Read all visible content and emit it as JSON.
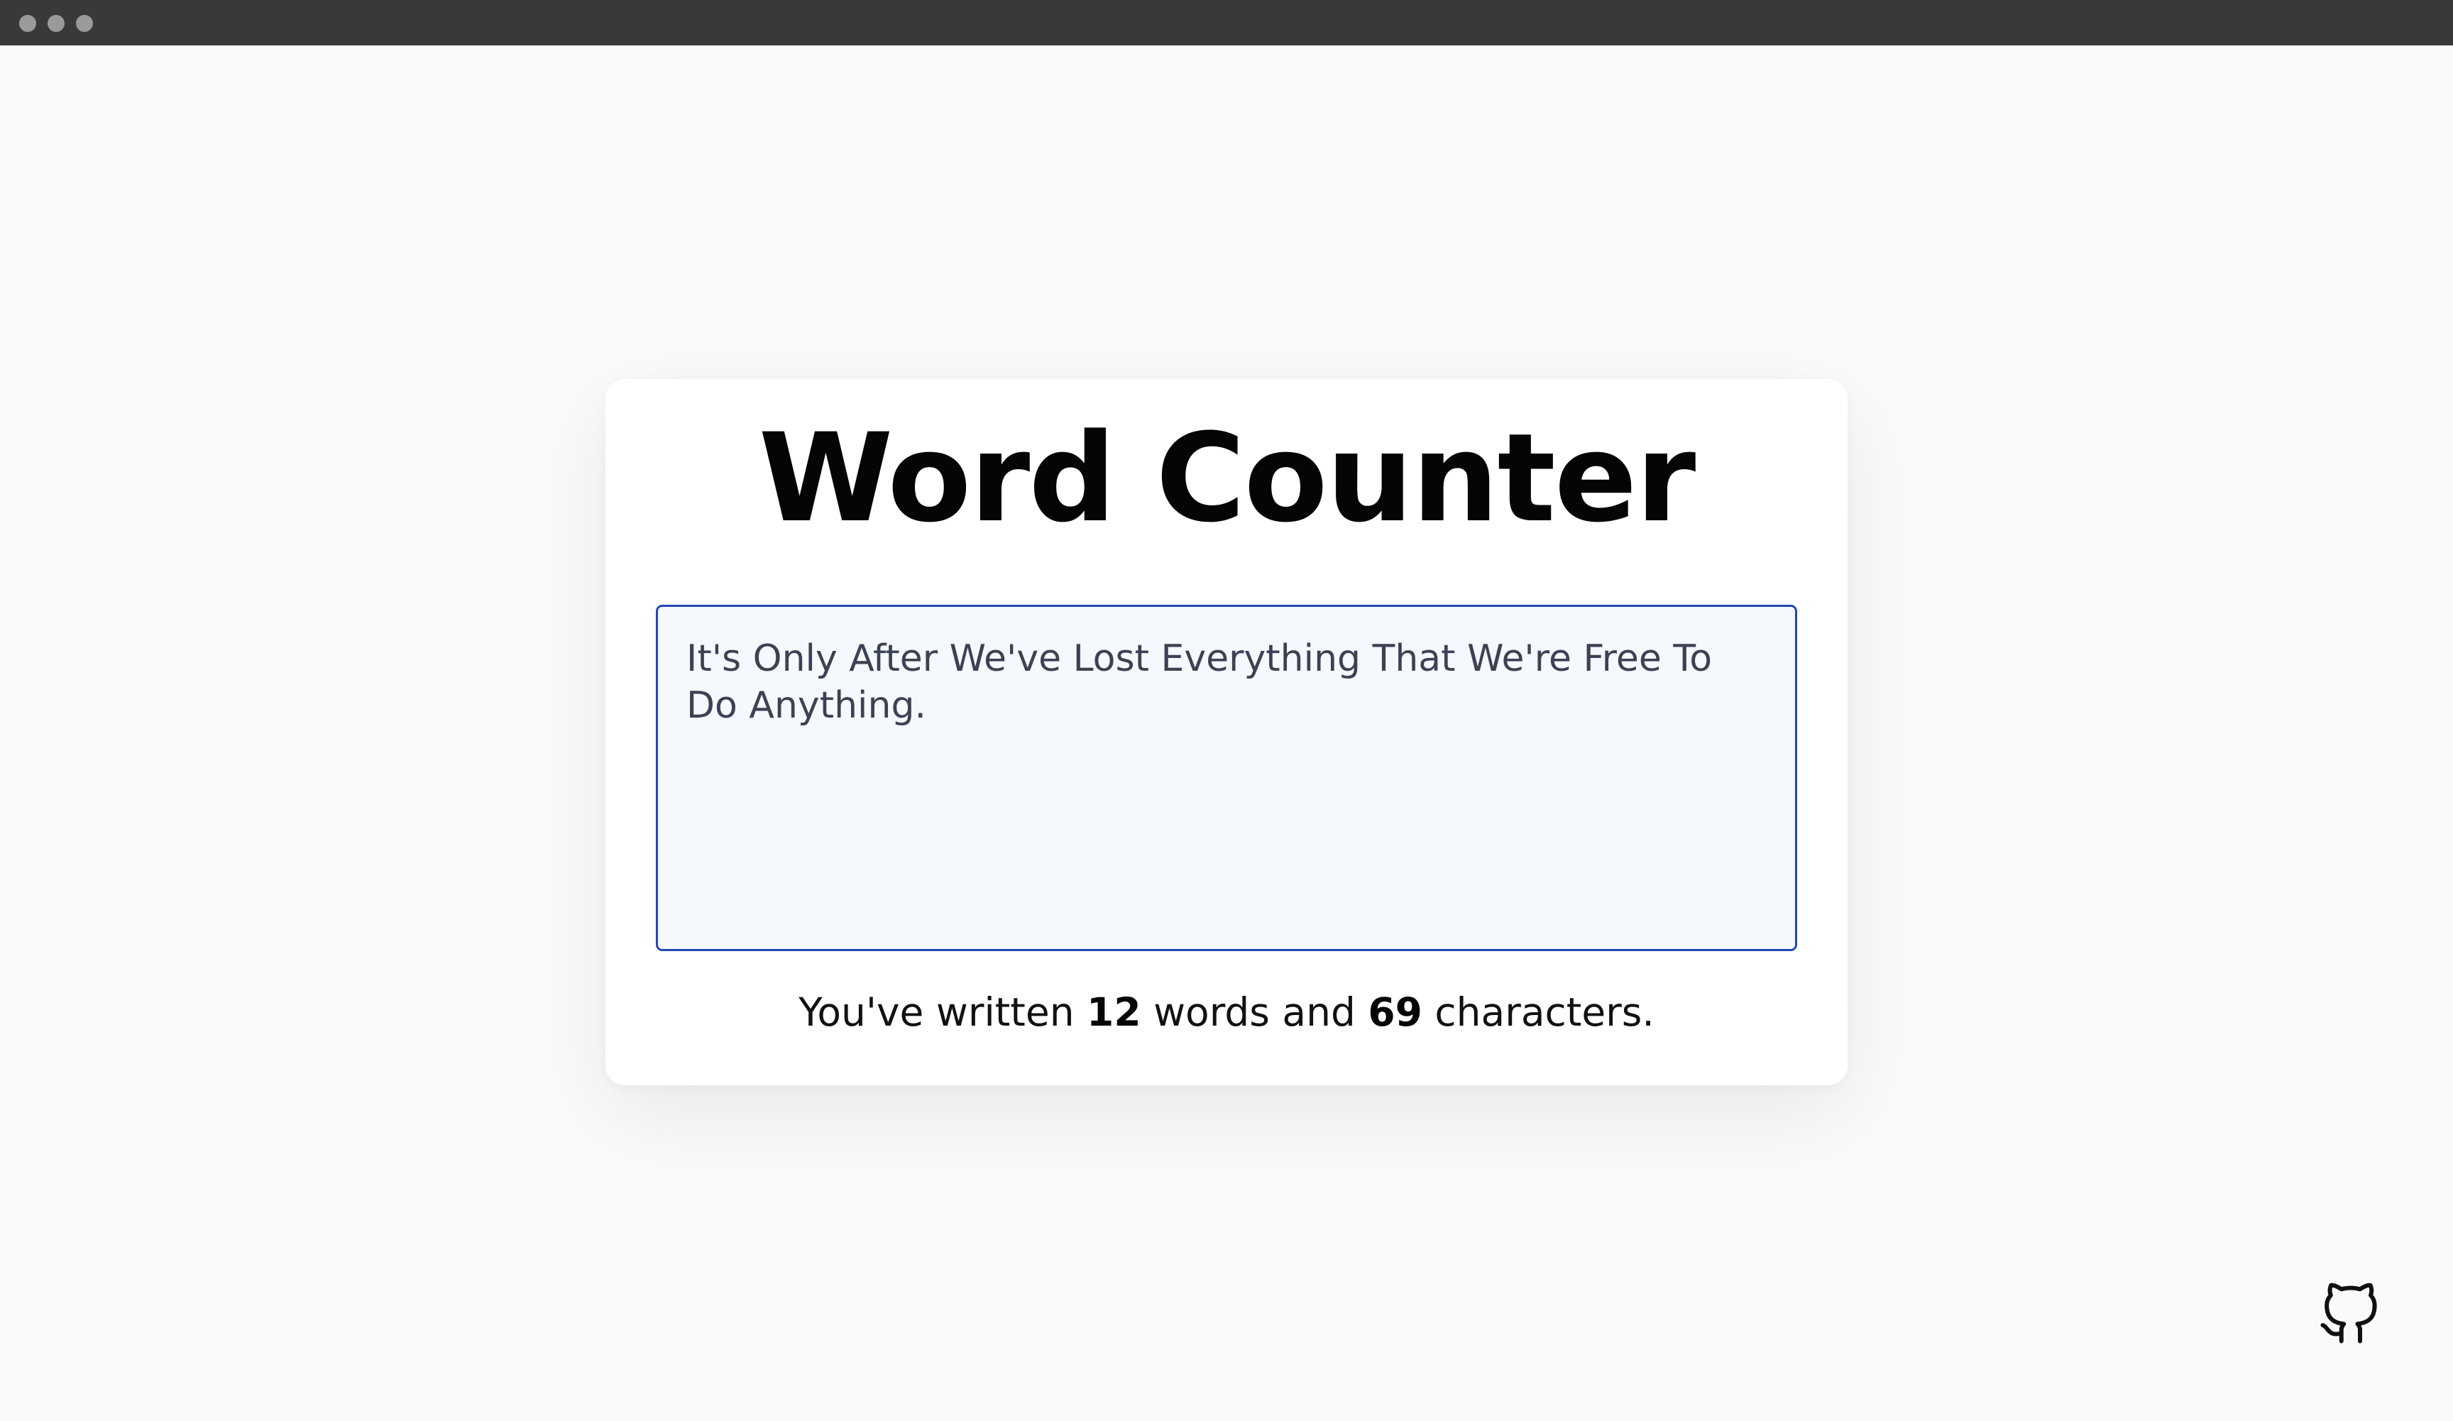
{
  "window": {
    "controls": [
      "close-dot",
      "minimize-dot",
      "zoom-dot"
    ]
  },
  "app": {
    "title": "Word Counter",
    "input_text": "It's Only After We've Lost Everything That We're Free To Do Anything.",
    "input_placeholder": ""
  },
  "stats": {
    "prefix": "You've written",
    "word_count": "12",
    "middle": "words and",
    "char_count": "69",
    "suffix": "characters."
  },
  "footer": {
    "icon": "github-icon"
  },
  "colors": {
    "page_bg": "#fafafa",
    "titlebar_bg": "#38393b",
    "card_bg": "#ffffff",
    "textarea_border": "#2346b6",
    "textarea_bg": "#f5f8fc",
    "textarea_text": "#3c4254"
  }
}
